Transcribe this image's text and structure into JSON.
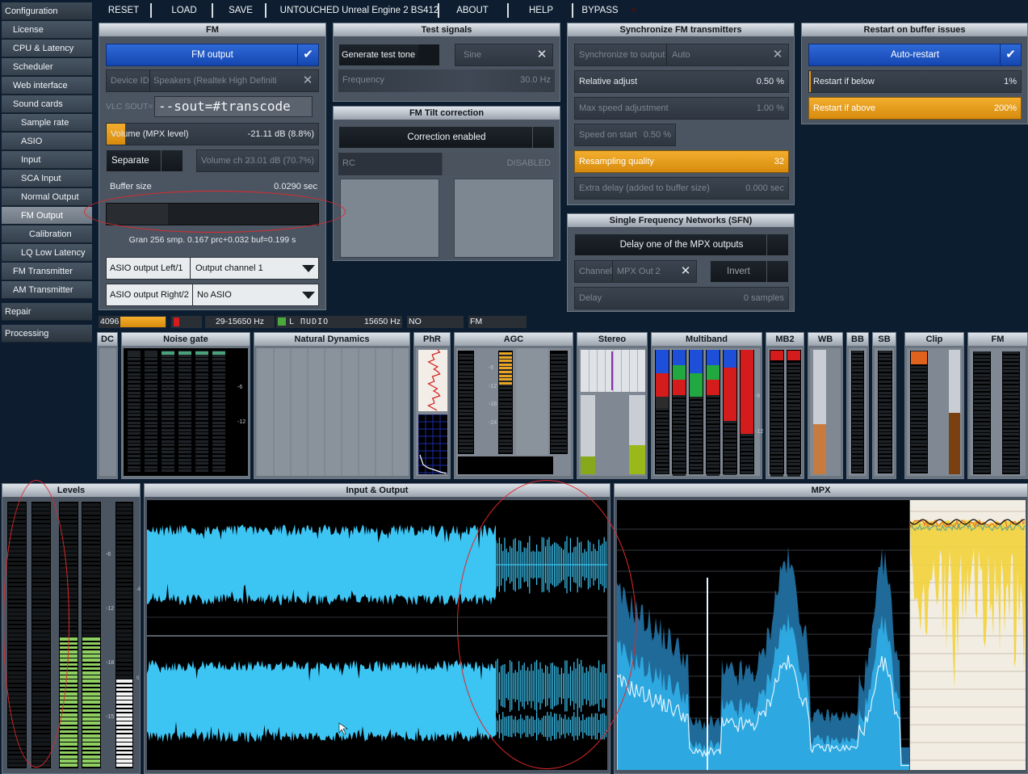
{
  "sidebar": {
    "items": [
      {
        "label": "Configuration",
        "level": "top",
        "selected": false
      },
      {
        "label": "License",
        "level": "sub",
        "selected": false
      },
      {
        "label": "CPU & Latency",
        "level": "sub",
        "selected": false
      },
      {
        "label": "Scheduler",
        "level": "sub",
        "selected": false
      },
      {
        "label": "Web interface",
        "level": "sub",
        "selected": false
      },
      {
        "label": "Sound cards",
        "level": "sub",
        "selected": false
      },
      {
        "label": "Sample rate",
        "level": "sub2",
        "selected": false
      },
      {
        "label": "ASIO",
        "level": "sub2",
        "selected": false
      },
      {
        "label": "Input",
        "level": "sub2",
        "selected": false
      },
      {
        "label": "SCA Input",
        "level": "sub2",
        "selected": false
      },
      {
        "label": "Normal Output",
        "level": "sub2",
        "selected": false
      },
      {
        "label": "FM Output",
        "level": "sub2",
        "selected": true
      },
      {
        "label": "Calibration",
        "level": "sub2x",
        "selected": false
      },
      {
        "label": "LQ Low Latency",
        "level": "sub2",
        "selected": false
      },
      {
        "label": "FM Transmitter",
        "level": "sub",
        "selected": false
      },
      {
        "label": "AM Transmitter",
        "level": "sub",
        "selected": false
      },
      {
        "label": "Repair",
        "level": "top",
        "selected": false
      },
      {
        "label": "Processing",
        "level": "top",
        "selected": false
      }
    ]
  },
  "toolbar": {
    "reset": "RESET",
    "load": "LOAD",
    "save": "SAVE",
    "preset": "UNTOUCHED Unreal Engine 2 BS412",
    "about": "ABOUT",
    "help": "HELP",
    "bypass": "BYPASS"
  },
  "fm": {
    "title": "FM",
    "fm_output": "FM output",
    "device_label": "Device ID",
    "device_value": "Speakers (Realtek High Definiti",
    "vlc_label": "VLC SOUT=",
    "vlc_value": "--sout=#transcode",
    "volume_label": "Volume (MPX level)",
    "volume_value": "-21.11 dB (8.8%)",
    "volume_fill": 0.088,
    "separate": "Separate",
    "volume_ch2_label": "Volume ch 2",
    "volume_ch2_value": "-3.01 dB (70.7%)",
    "buffer_label": "Buffer size",
    "buffer_value": "0.0290 sec",
    "gran_text": "Gran 256 smp. 0.167 prc+0.032 buf=0.199 s",
    "asio_left_label": "ASIO output Left/1",
    "asio_left_value": "Output channel 1",
    "asio_right_label": "ASIO output Right/2",
    "asio_right_value": "No ASIO"
  },
  "test_signals": {
    "title": "Test signals",
    "generate": "Generate test tone",
    "waveform": "Sine",
    "frequency_label": "Frequency",
    "frequency_value": "30.0 Hz"
  },
  "tilt": {
    "title": "FM Tilt correction",
    "correction": "Correction enabled",
    "rc_label": "RC",
    "rc_value": "DISABLED"
  },
  "sync": {
    "title": "Synchronize FM transmitters",
    "sync_label": "Synchronize to output",
    "sync_value": "Auto",
    "relative_label": "Relative adjust",
    "relative_value": "0.50 %",
    "maxspeed_label": "Max speed adjustment",
    "maxspeed_value": "1.00 %",
    "speedstart_label": "Speed on start",
    "speedstart_value": "0.50 %",
    "resampling_label": "Resampling quality",
    "resampling_value": "32",
    "extra_label": "Extra delay (added to buffer size)",
    "extra_value": "0.000 sec"
  },
  "sfn": {
    "title": "Single Frequency Networks (SFN)",
    "delay_one": "Delay one of the MPX outputs",
    "channel_label": "Channel",
    "channel_value": "MPX Out 2",
    "invert": "Invert",
    "delay_label": "Delay",
    "delay_value": "0 samples"
  },
  "restart": {
    "title": "Restart on buffer issues",
    "auto": "Auto-restart",
    "below_label": "Restart if below",
    "below_value": "1%",
    "above_label": "Restart if above",
    "above_value": "200%"
  },
  "statusbar": {
    "buffer": "4096",
    "freq_range": "29-15650 Hz",
    "lcd_text": "L  ΠUDIO",
    "freq2": "15650 Hz",
    "no": "NO",
    "fm": "FM"
  },
  "meters": {
    "titles": [
      "DC",
      "Noise gate",
      "Natural Dynamics",
      "PhR",
      "AGC",
      "Stereo",
      "Multiband",
      "MB2",
      "WB",
      "BB",
      "SB",
      "Clip",
      "FM"
    ],
    "scale_6": "-6",
    "scale_12": "-12",
    "scale_18": "-18",
    "scale_15": "-15",
    "scale_0": "0",
    "scale_24": "-24"
  },
  "bottom": {
    "levels": "Levels",
    "io": "Input & Output",
    "mpx": "MPX"
  },
  "colors": {
    "accent_blue": "#1e58c8",
    "accent_orange": "#f0a020",
    "waveform": "#3cc4f2",
    "annotation": "#e0282a"
  }
}
